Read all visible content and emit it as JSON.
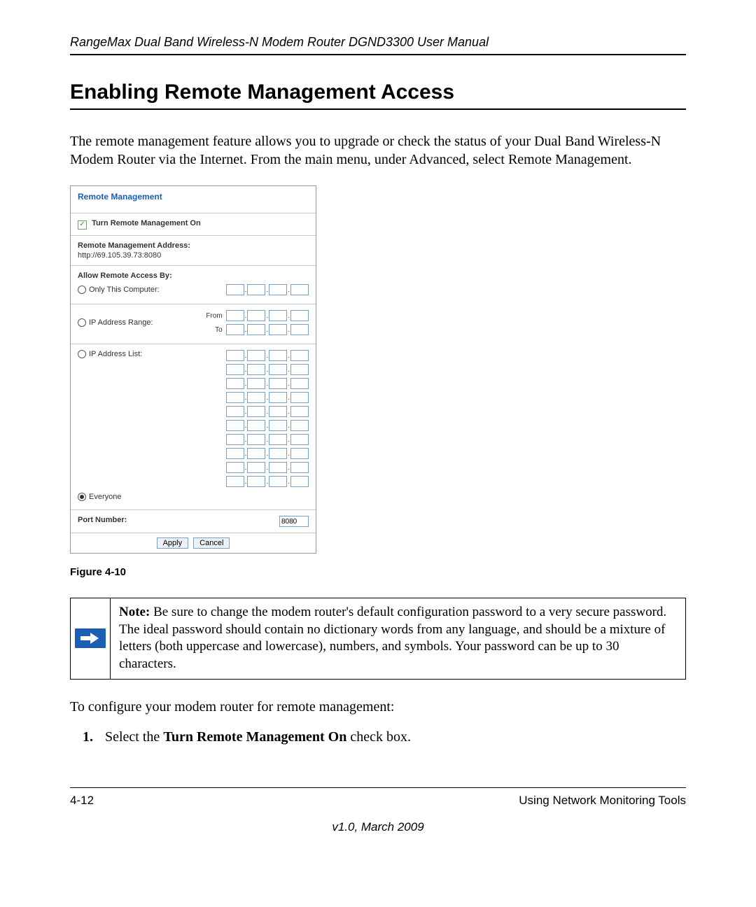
{
  "header": "RangeMax Dual Band Wireless-N Modem Router DGND3300 User Manual",
  "title": "Enabling Remote Management Access",
  "intro": "The remote management feature allows you to upgrade or check the status of your Dual Band Wireless-N Modem Router via the Internet. From the main menu, under Advanced, select Remote Management.",
  "ui": {
    "card_title": "Remote Management",
    "turn_on_label": "Turn Remote Management On",
    "addr_label": "Remote Management Address:",
    "addr_value": "http://69.105.39.73:8080",
    "allow_label": "Allow Remote Access By:",
    "opt_only": "Only This Computer:",
    "opt_range": "IP Address Range:",
    "range_from": "From",
    "range_to": "To",
    "opt_list": "IP Address List:",
    "opt_everyone": "Everyone",
    "port_label": "Port Number:",
    "port_value": "8080",
    "apply": "Apply",
    "cancel": "Cancel"
  },
  "figure_label": "Figure 4-10",
  "note": {
    "bold": "Note:",
    "rest": " Be sure to change the modem router's default configuration password to a very secure password. The ideal password should contain no dictionary words from any language, and should be a mixture of letters (both uppercase and lowercase), numbers, and symbols. Your password can be up to 30 characters."
  },
  "after_note": "To configure your modem router for remote management:",
  "step1": {
    "num": "1.",
    "pre": "Select the ",
    "bold": "Turn Remote Management On",
    "post": " check box."
  },
  "footer": {
    "left": "4-12",
    "right": "Using Network Monitoring Tools",
    "version": "v1.0, March 2009"
  }
}
